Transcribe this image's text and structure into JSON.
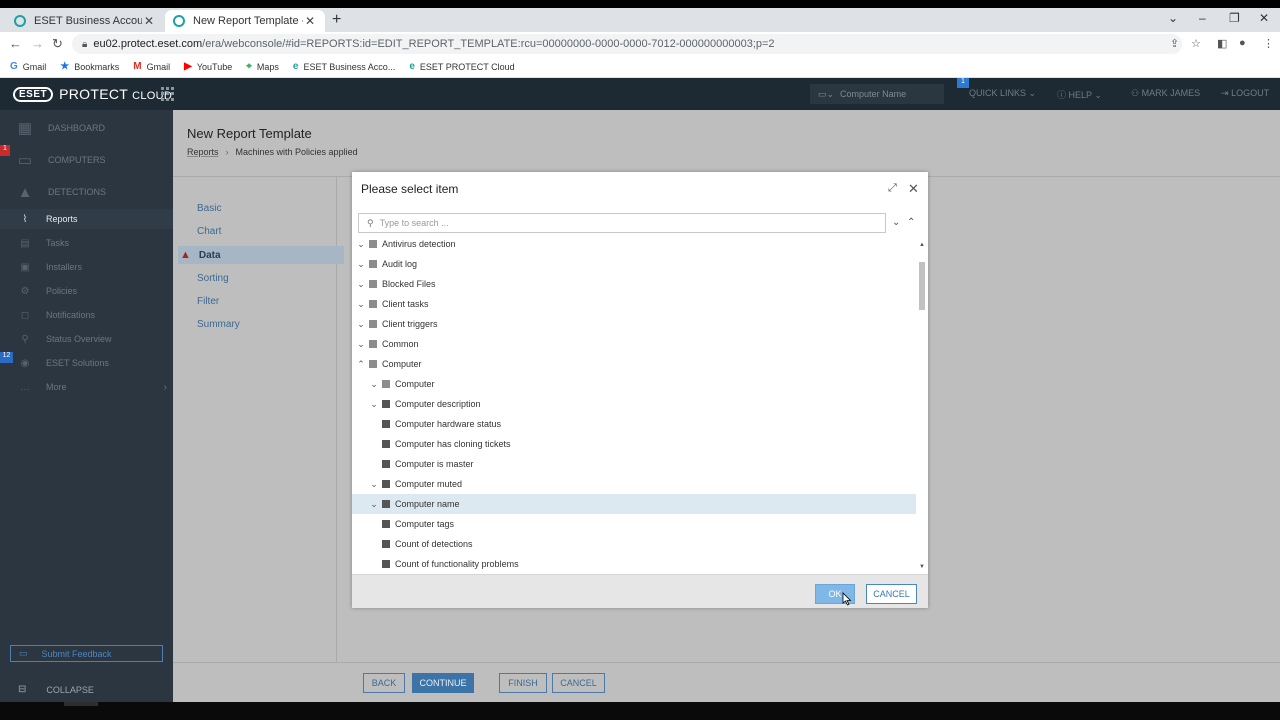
{
  "browser": {
    "tabs": [
      {
        "title": "ESET Business Account",
        "close": "✕"
      },
      {
        "title": "New Report Template - ESET PRO",
        "close": "✕"
      }
    ],
    "new_tab": "+",
    "window_controls": {
      "dropdown": "⌄",
      "minimize": "–",
      "restore": "❐",
      "close": "✕"
    },
    "url_host": "eu02.protect.eset.com",
    "url_path": "/era/webconsole/#id=REPORTS:id=EDIT_REPORT_TEMPLATE:rcu=00000000-0000-0000-7012-000000000003;p=2",
    "bookmarks": [
      {
        "label": "Gmail",
        "icon": "G",
        "color": "#4285f4"
      },
      {
        "label": "Bookmarks",
        "icon": "★",
        "color": "#1a73e8"
      },
      {
        "label": "Gmail",
        "icon": "M",
        "color": "#d93025"
      },
      {
        "label": "YouTube",
        "icon": "▶",
        "color": "#ff0000"
      },
      {
        "label": "Maps",
        "icon": "⌖",
        "color": "#34a853"
      },
      {
        "label": "ESET Business Acco...",
        "icon": "e",
        "color": "#1ea1a1"
      },
      {
        "label": "ESET PROTECT Cloud",
        "icon": "e",
        "color": "#1ea1a1"
      }
    ]
  },
  "header": {
    "logo_mark": "ESET",
    "product": "PROTECT",
    "product_suffix": "CLOUD",
    "search_placeholder": "Computer Name",
    "quick_links": "QUICK LINKS",
    "quick_links_badge": "1",
    "help": "HELP",
    "user": "MARK JAMES",
    "logout": "LOGOUT"
  },
  "sidebar": {
    "main": [
      {
        "label": "DASHBOARD",
        "icon": "dashboard-icon"
      },
      {
        "label": "COMPUTERS",
        "icon": "computers-icon",
        "badge": "1"
      },
      {
        "label": "DETECTIONS",
        "icon": "detections-icon"
      }
    ],
    "sub": [
      {
        "label": "Reports",
        "icon": "reports-icon",
        "active": true
      },
      {
        "label": "Tasks",
        "icon": "tasks-icon"
      },
      {
        "label": "Installers",
        "icon": "installers-icon"
      },
      {
        "label": "Policies",
        "icon": "policies-icon"
      },
      {
        "label": "Notifications",
        "icon": "notifications-icon"
      },
      {
        "label": "Status Overview",
        "icon": "status-icon"
      },
      {
        "label": "ESET Solutions",
        "icon": "solutions-icon",
        "badge": "12"
      },
      {
        "label": "More",
        "icon": "more-icon"
      }
    ],
    "feedback": "Submit Feedback",
    "collapse": "COLLAPSE"
  },
  "main": {
    "title": "New Report Template",
    "breadcrumb": {
      "root": "Reports",
      "current": "Machines with Policies applied"
    },
    "steps": [
      "Basic",
      "Chart",
      "Data",
      "Sorting",
      "Filter",
      "Summary"
    ],
    "active_step": "Data",
    "footer": {
      "back": "BACK",
      "continue": "CONTINUE",
      "finish": "FINISH",
      "cancel": "CANCEL"
    }
  },
  "dialog": {
    "title": "Please select item",
    "search_placeholder": "Type to search ...",
    "rows": [
      {
        "label": "Antivirus detection",
        "level": 0,
        "expanded": false,
        "has_children": true
      },
      {
        "label": "Audit log",
        "level": 0,
        "expanded": false,
        "has_children": true
      },
      {
        "label": "Blocked Files",
        "level": 0,
        "expanded": false,
        "has_children": true
      },
      {
        "label": "Client tasks",
        "level": 0,
        "expanded": false,
        "has_children": true
      },
      {
        "label": "Client triggers",
        "level": 0,
        "expanded": false,
        "has_children": true
      },
      {
        "label": "Common",
        "level": 0,
        "expanded": false,
        "has_children": true
      },
      {
        "label": "Computer",
        "level": 0,
        "expanded": true,
        "has_children": true
      },
      {
        "label": "Computer",
        "level": 1,
        "expanded": false,
        "has_children": true
      },
      {
        "label": "Computer description",
        "level": 1,
        "expanded": false,
        "has_children": true,
        "dark": true
      },
      {
        "label": "Computer hardware status",
        "level": 1,
        "has_children": false,
        "dark": true
      },
      {
        "label": "Computer has cloning tickets",
        "level": 1,
        "has_children": false,
        "dark": true
      },
      {
        "label": "Computer is master",
        "level": 1,
        "has_children": false,
        "dark": true
      },
      {
        "label": "Computer muted",
        "level": 1,
        "expanded": false,
        "has_children": true,
        "dark": true
      },
      {
        "label": "Computer name",
        "level": 1,
        "expanded": false,
        "has_children": true,
        "dark": true,
        "selected": true
      },
      {
        "label": "Computer tags",
        "level": 1,
        "has_children": false,
        "dark": true
      },
      {
        "label": "Count of detections",
        "level": 1,
        "has_children": false,
        "dark": true
      },
      {
        "label": "Count of functionality problems",
        "level": 1,
        "has_children": false,
        "dark": true
      }
    ],
    "ok": "OK",
    "cancel": "CANCEL"
  }
}
